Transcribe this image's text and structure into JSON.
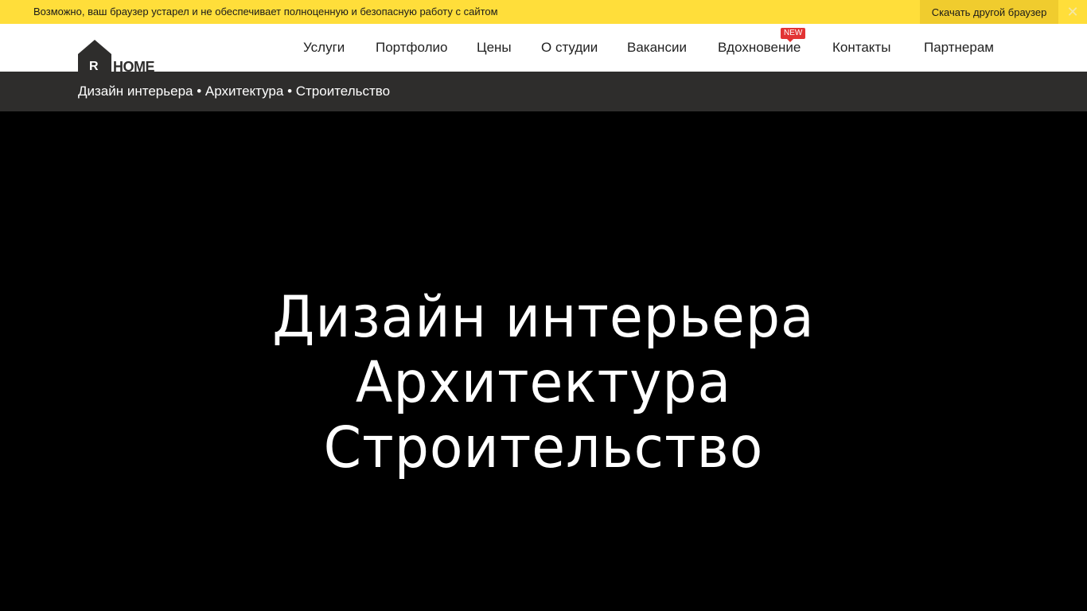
{
  "browser_warning": {
    "message": "Возможно, ваш браузер устарел и не обеспечивает полноценную и безопасную работу с сайтом",
    "download_label": "Скачать другой браузер",
    "close_glyph": "✕"
  },
  "logo": {
    "letter": "R",
    "word": "HOME"
  },
  "nav": {
    "items": [
      {
        "label": "Услуги"
      },
      {
        "label": "Портфолио"
      },
      {
        "label": "Цены"
      },
      {
        "label": "О студии"
      },
      {
        "label": "Вакансии"
      },
      {
        "label": "Вдохновение"
      },
      {
        "label": "Контакты"
      },
      {
        "label": "Партнерам"
      }
    ],
    "badge": "NEW"
  },
  "subbar": {
    "tagline": "Дизайн интерьера • Архитектура • Строительство"
  },
  "hero": {
    "lines": [
      "Дизайн интерьера",
      "Архитектура",
      "Строительство"
    ]
  },
  "colors": {
    "warning_bg": "#ffde3a",
    "subbar_bg": "#2e2d2c",
    "badge": "#e23434"
  }
}
